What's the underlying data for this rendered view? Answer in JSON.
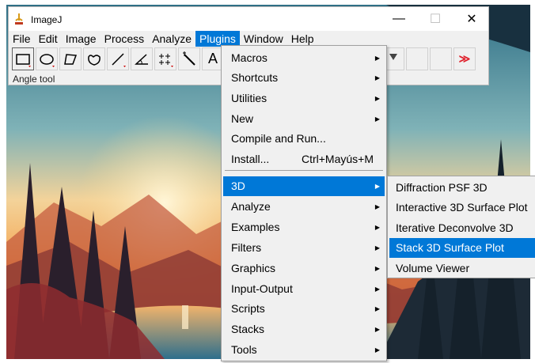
{
  "window": {
    "title": "ImageJ",
    "minimize_glyph": "—",
    "maximize_glyph": "☐",
    "close_glyph": "✕"
  },
  "menubar": {
    "items": [
      "File",
      "Edit",
      "Image",
      "Process",
      "Analyze",
      "Plugins",
      "Window",
      "Help"
    ],
    "active": "Plugins"
  },
  "toolbar": {
    "tools": [
      "rectangle-tool",
      "oval-tool",
      "polygon-tool",
      "freehand-tool",
      "line-tool",
      "angle-tool",
      "point-tool",
      "wand-tool",
      "text-tool"
    ],
    "text_tool_glyph": "A",
    "more_tools_glyph": "≫"
  },
  "status": {
    "text": "Angle tool"
  },
  "plugins_menu": {
    "items": [
      {
        "label": "Macros",
        "submenu": true
      },
      {
        "label": "Shortcuts",
        "submenu": true
      },
      {
        "label": "Utilities",
        "submenu": true
      },
      {
        "label": "New",
        "submenu": true
      },
      {
        "label": "Compile and Run...",
        "submenu": false
      },
      {
        "label": "Install...",
        "shortcut": "Ctrl+Mayús+M",
        "submenu": false
      },
      {
        "label": "3D",
        "submenu": true,
        "highlighted": true
      },
      {
        "label": "Analyze",
        "submenu": true
      },
      {
        "label": "Examples",
        "submenu": true
      },
      {
        "label": "Filters",
        "submenu": true
      },
      {
        "label": "Graphics",
        "submenu": true
      },
      {
        "label": "Input-Output",
        "submenu": true
      },
      {
        "label": "Scripts",
        "submenu": true
      },
      {
        "label": "Stacks",
        "submenu": true
      },
      {
        "label": "Tools",
        "submenu": true
      }
    ]
  },
  "submenu_3d": {
    "items": [
      {
        "label": "Diffraction PSF 3D"
      },
      {
        "label": "Interactive 3D Surface Plot"
      },
      {
        "label": "Iterative Deconvolve 3D"
      },
      {
        "label": "Stack 3D Surface Plot",
        "highlighted": true
      },
      {
        "label": "Volume Viewer"
      }
    ]
  },
  "colors": {
    "menu_highlight": "#0078d7",
    "menu_bg": "#f0f0f0",
    "more_tools": "#e0202b"
  }
}
